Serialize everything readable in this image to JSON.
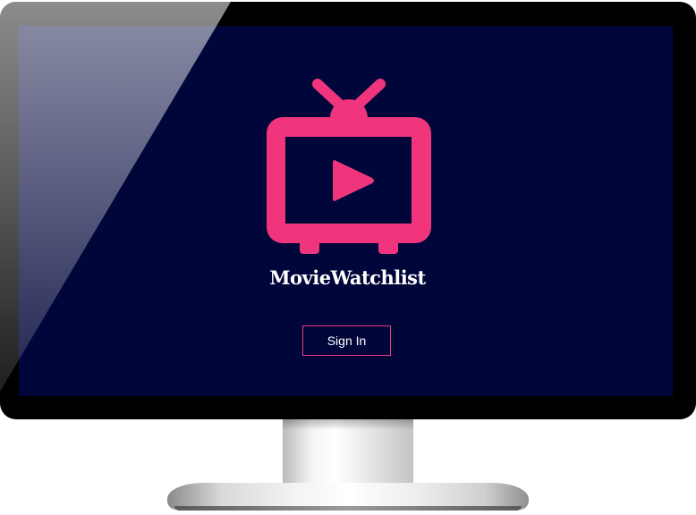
{
  "app": {
    "brand_title": "MovieWatchlist",
    "sign_in_label": "Sign In",
    "logo_icon": "tv-play-icon"
  },
  "colors": {
    "background": "#01063a",
    "accent": "#f0357d",
    "text": "#ffffff",
    "bezel": "#000000"
  }
}
